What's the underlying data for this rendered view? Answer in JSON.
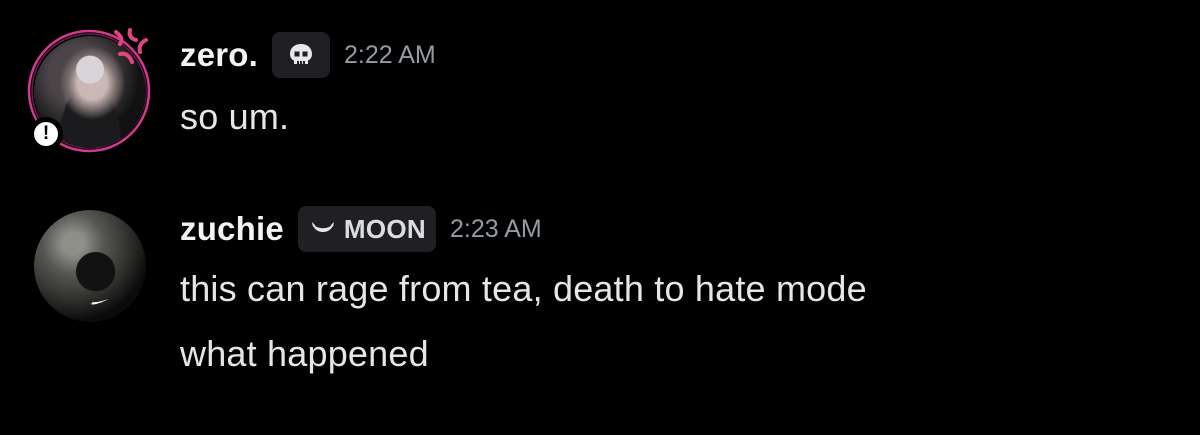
{
  "messages": [
    {
      "username": "zero.",
      "tag_icon": "skull-icon",
      "tag_label": "",
      "timestamp": "2:22 AM",
      "lines": [
        "so um."
      ],
      "status_badge": "!",
      "ring_color": "#d13a8f",
      "accent_icon": "anger-symbol-icon"
    },
    {
      "username": "zuchie",
      "tag_icon": "crescent-moon-icon",
      "tag_label": "MOON",
      "timestamp": "2:23 AM",
      "lines": [
        "this can rage from tea, death to hate mode",
        "what happened"
      ]
    }
  ],
  "colors": {
    "background": "#000000",
    "username": "#f2f3f5",
    "timestamp": "#949ba4",
    "message_text": "#e6e6e9",
    "tag_background": "#202024",
    "accent_pink": "#e0457b"
  }
}
